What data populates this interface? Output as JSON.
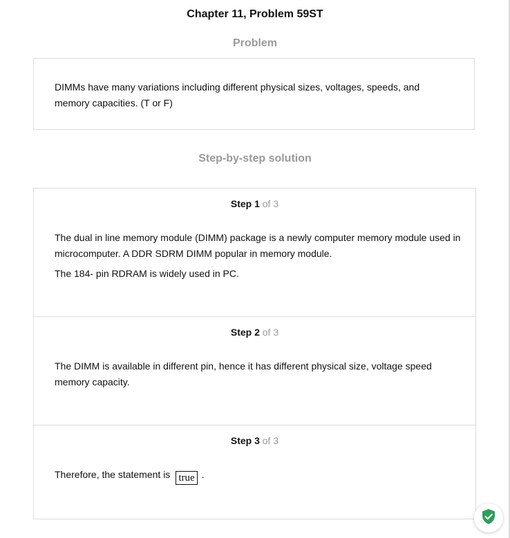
{
  "chapter_title": "Chapter 11, Problem 59ST",
  "problem": {
    "heading": "Problem",
    "text": "DIMMs have many variations including different physical sizes, voltages, speeds, and memory capacities. (T or F)"
  },
  "solution": {
    "heading": "Step-by-step solution",
    "steps": [
      {
        "label": "Step 1",
        "of": "of 3",
        "paragraphs": [
          "The dual in line memory module (DIMM) package is a newly computer memory module used in microcomputer. A DDR SDRM DIMM popular in memory module.",
          "The 184- pin RDRAM is widely used in PC."
        ]
      },
      {
        "label": "Step 2",
        "of": "of 3",
        "paragraphs": [
          "The DIMM is available in different pin, hence it has different physical size, voltage speed memory capacity."
        ]
      },
      {
        "label": "Step 3",
        "of": "of 3",
        "prefix": "Therefore, the statement is",
        "answer": "true",
        "suffix": "."
      }
    ]
  },
  "badge": {
    "icon": "shield-check-icon",
    "color": "#2e9e5b"
  }
}
